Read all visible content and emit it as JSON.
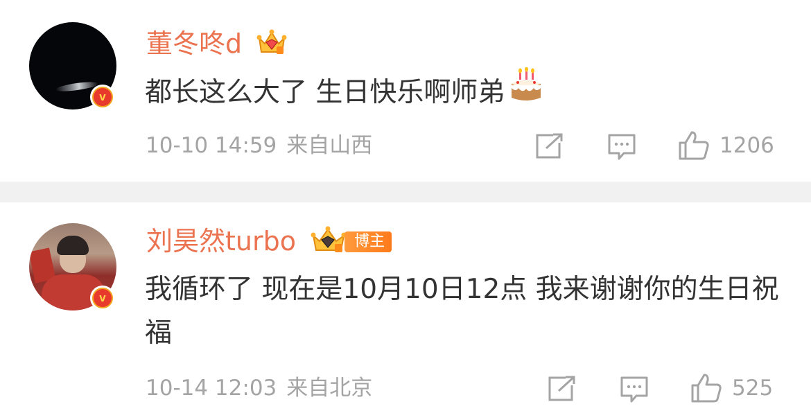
{
  "comments": [
    {
      "username": "董冬咚d",
      "text": "都长这么大了 生日快乐啊师弟",
      "time": "10-10 14:59",
      "location": "来自山西",
      "likes": "1206",
      "badge": "crown-icon",
      "verified_icon": "v-badge-icon",
      "verified_letter": "v"
    },
    {
      "username": "刘昊然turbo",
      "badge_label": "博主",
      "text": "我循环了 现在是10月10日12点 我来谢谢你的生日祝福",
      "time": "10-14 12:03",
      "location": "来自北京",
      "likes": "525",
      "badge": "crown-icon",
      "verified_icon": "v-badge-icon",
      "verified_letter": "v"
    }
  ],
  "colors": {
    "username": "#eb7350",
    "text": "#333333",
    "meta": "#a4a4a4",
    "divider": "#f1f1f1",
    "verified_ring": "#f3a61f",
    "verified_fill": "#e8392d"
  }
}
